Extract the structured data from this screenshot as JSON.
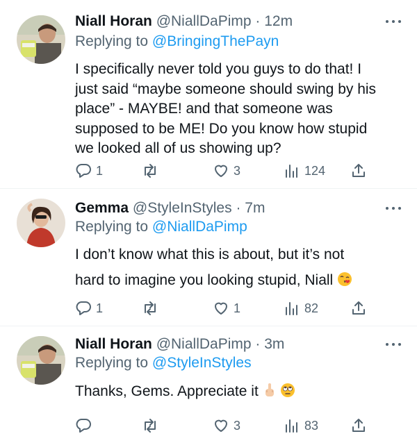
{
  "tweets": [
    {
      "name": "Niall Horan",
      "handle": "@NiallDaPimp",
      "dot": "·",
      "time": "12m",
      "replying_prefix": "Replying to",
      "replying_to": "@BringingThePayn",
      "text_lines": [
        "I specifically never told you guys to do that! I",
        "just said “maybe someone should swing by his",
        "place” - MAYBE! and that someone was",
        "supposed to be ME! Do you know how stupid",
        "we looked all of us showing up?"
      ],
      "replies": "1",
      "retweets": "",
      "likes": "3",
      "views": "124"
    },
    {
      "name": "Gemma",
      "handle": "@StyleInStyles",
      "dot": "·",
      "time": "7m",
      "replying_prefix": "Replying to",
      "replying_to": "@NiallDaPimp",
      "text_lines": [
        "I don’t know what this is about, but it’s not",
        "hard to imagine you looking stupid, Niall"
      ],
      "replies": "1",
      "retweets": "",
      "likes": "1",
      "views": "82"
    },
    {
      "name": "Niall Horan",
      "handle": "@NiallDaPimp",
      "dot": "·",
      "time": "3m",
      "replying_prefix": "Replying to",
      "replying_to": "@StyleInStyles",
      "text_lines": [
        "Thanks, Gems. Appreciate it"
      ],
      "replies": "",
      "retweets": "",
      "likes": "3",
      "views": "83"
    }
  ],
  "icons": {
    "more": "more-horizontal-icon",
    "reply": "reply-icon",
    "retweet": "retweet-icon",
    "like": "heart-icon",
    "views": "views-chart-icon",
    "share": "share-icon",
    "wink_kiss": "face-blowing-kiss-emoji",
    "middle_finger": "middle-finger-emoji",
    "eye_roll": "face-rolling-eyes-emoji"
  },
  "colors": {
    "text": "#0f1419",
    "secondary": "#536471",
    "link": "#1d9bf0",
    "divider": "#eff3f4"
  }
}
